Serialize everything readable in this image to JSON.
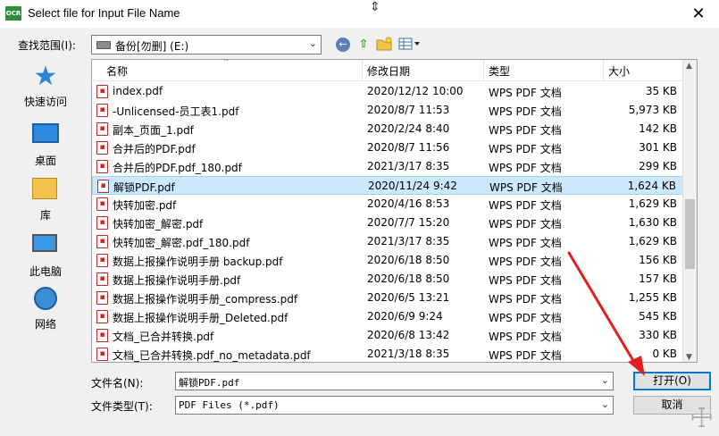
{
  "window": {
    "title": "Select file for Input File Name",
    "app_icon_text": "OCR",
    "close_glyph": "✕"
  },
  "toolbar": {
    "lookin_label": "查找范围(I):",
    "lookin_value": "备份[勿删] (E:)",
    "back_icon": "back-icon",
    "up_icon": "up-folder-icon",
    "newfolder_icon": "new-folder-icon",
    "view_icon": "view-menu-icon"
  },
  "places": [
    {
      "label": "快速访问",
      "icon": "quick-access-icon"
    },
    {
      "label": "桌面",
      "icon": "desktop-icon"
    },
    {
      "label": "库",
      "icon": "libraries-icon"
    },
    {
      "label": "此电脑",
      "icon": "this-pc-icon"
    },
    {
      "label": "网络",
      "icon": "network-icon"
    }
  ],
  "columns": {
    "name": "名称",
    "date": "修改日期",
    "type": "类型",
    "size": "大小"
  },
  "files": [
    {
      "name": "index.pdf",
      "date": "2020/12/12 10:00",
      "type": "WPS PDF 文档",
      "size": "35 KB"
    },
    {
      "name": "-Unlicensed-员工表1.pdf",
      "date": "2020/8/7 11:53",
      "type": "WPS PDF 文档",
      "size": "5,973 KB"
    },
    {
      "name": "副本_页面_1.pdf",
      "date": "2020/2/24 8:40",
      "type": "WPS PDF 文档",
      "size": "142 KB"
    },
    {
      "name": "合并后的PDF.pdf",
      "date": "2020/8/7 11:56",
      "type": "WPS PDF 文档",
      "size": "301 KB"
    },
    {
      "name": "合并后的PDF.pdf_180.pdf",
      "date": "2021/3/17 8:35",
      "type": "WPS PDF 文档",
      "size": "299 KB"
    },
    {
      "name": "解锁PDF.pdf",
      "date": "2020/11/24 9:42",
      "type": "WPS PDF 文档",
      "size": "1,624 KB"
    },
    {
      "name": "快转加密.pdf",
      "date": "2020/4/16 8:53",
      "type": "WPS PDF 文档",
      "size": "1,629 KB"
    },
    {
      "name": "快转加密_解密.pdf",
      "date": "2020/7/7 15:20",
      "type": "WPS PDF 文档",
      "size": "1,630 KB"
    },
    {
      "name": "快转加密_解密.pdf_180.pdf",
      "date": "2021/3/17 8:35",
      "type": "WPS PDF 文档",
      "size": "1,629 KB"
    },
    {
      "name": "数据上报操作说明手册 backup.pdf",
      "date": "2020/6/18 8:50",
      "type": "WPS PDF 文档",
      "size": "156 KB"
    },
    {
      "name": "数据上报操作说明手册.pdf",
      "date": "2020/6/18 8:50",
      "type": "WPS PDF 文档",
      "size": "157 KB"
    },
    {
      "name": "数据上报操作说明手册_compress.pdf",
      "date": "2020/6/5 13:21",
      "type": "WPS PDF 文档",
      "size": "1,255 KB"
    },
    {
      "name": "数据上报操作说明手册_Deleted.pdf",
      "date": "2020/6/9 9:24",
      "type": "WPS PDF 文档",
      "size": "545 KB"
    },
    {
      "name": "文档_已合并转换.pdf",
      "date": "2020/6/8 13:42",
      "type": "WPS PDF 文档",
      "size": "330 KB"
    },
    {
      "name": "文档_已合并转换.pdf_no_metadata.pdf",
      "date": "2021/3/18 8:35",
      "type": "WPS PDF 文档",
      "size": "0 KB"
    }
  ],
  "selected_file": "解锁PDF.pdf",
  "filename": {
    "label": "文件名(N):",
    "value": "解锁PDF.pdf"
  },
  "filetype": {
    "label": "文件类型(T):",
    "value": "PDF Files (*.pdf)"
  },
  "buttons": {
    "open": "打开(O)",
    "cancel": "取消"
  },
  "colors": {
    "selection": "#cce8ff",
    "annotation_arrow": "#e0201e",
    "default_button_border": "#0078d7"
  }
}
